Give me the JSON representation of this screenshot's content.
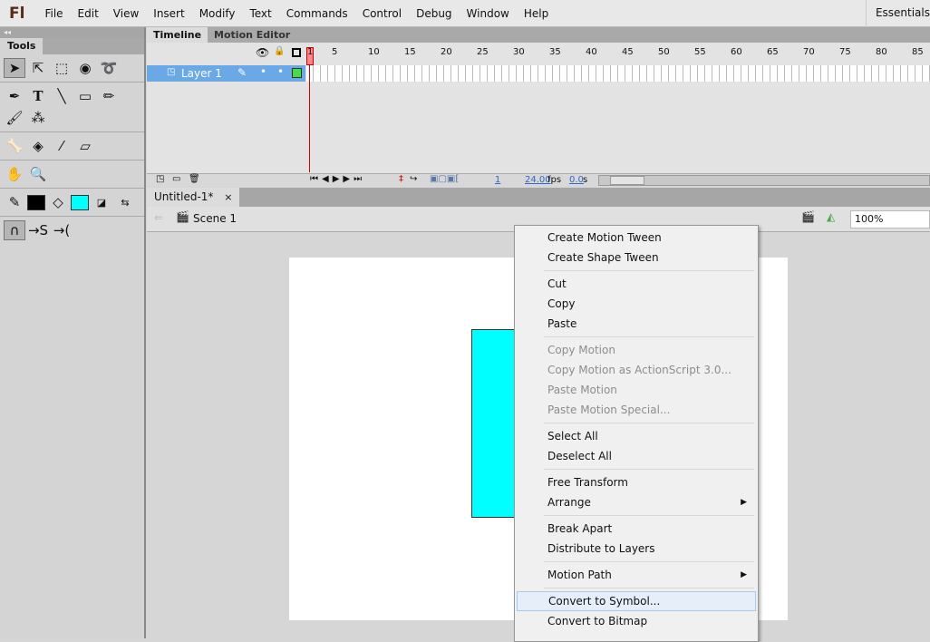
{
  "app": {
    "logo": "Fl",
    "menus": [
      "File",
      "Edit",
      "View",
      "Insert",
      "Modify",
      "Text",
      "Commands",
      "Control",
      "Debug",
      "Window",
      "Help"
    ],
    "workspace": "Essentials"
  },
  "tools": {
    "panel_title": "Tools",
    "stroke_color": "#000000",
    "fill_color": "#00ffff"
  },
  "timeline": {
    "tabs": [
      "Timeline",
      "Motion Editor"
    ],
    "frame_numbers": [
      "1",
      "5",
      "10",
      "15",
      "20",
      "25",
      "30",
      "35",
      "40",
      "45",
      "50",
      "55",
      "60",
      "65",
      "70",
      "75",
      "80",
      "85"
    ],
    "layer_name": "Layer 1",
    "layer_color": "#44dd44",
    "current_frame": "1",
    "fps": "24.00",
    "fps_unit": "fps",
    "time": "0.0",
    "time_unit": "s"
  },
  "document": {
    "tab": "Untitled-1*",
    "close": "×",
    "scene": "Scene 1",
    "zoom": "100%"
  },
  "stage": {
    "shape_color": "#00ffff"
  },
  "context_menu": {
    "groups": [
      [
        {
          "label": "Create Motion Tween"
        },
        {
          "label": "Create Shape Tween"
        }
      ],
      [
        {
          "label": "Cut"
        },
        {
          "label": "Copy"
        },
        {
          "label": "Paste"
        }
      ],
      [
        {
          "label": "Copy Motion",
          "disabled": true
        },
        {
          "label": "Copy Motion as ActionScript 3.0...",
          "disabled": true
        },
        {
          "label": "Paste Motion",
          "disabled": true
        },
        {
          "label": "Paste Motion Special...",
          "disabled": true
        }
      ],
      [
        {
          "label": "Select All"
        },
        {
          "label": "Deselect All"
        }
      ],
      [
        {
          "label": "Free Transform"
        },
        {
          "label": "Arrange",
          "submenu": true
        }
      ],
      [
        {
          "label": "Break Apart"
        },
        {
          "label": "Distribute to Layers"
        }
      ],
      [
        {
          "label": "Motion Path",
          "submenu": true
        }
      ],
      [
        {
          "label": "Convert to Symbol...",
          "highlighted": true
        },
        {
          "label": "Convert to Bitmap"
        }
      ]
    ]
  }
}
